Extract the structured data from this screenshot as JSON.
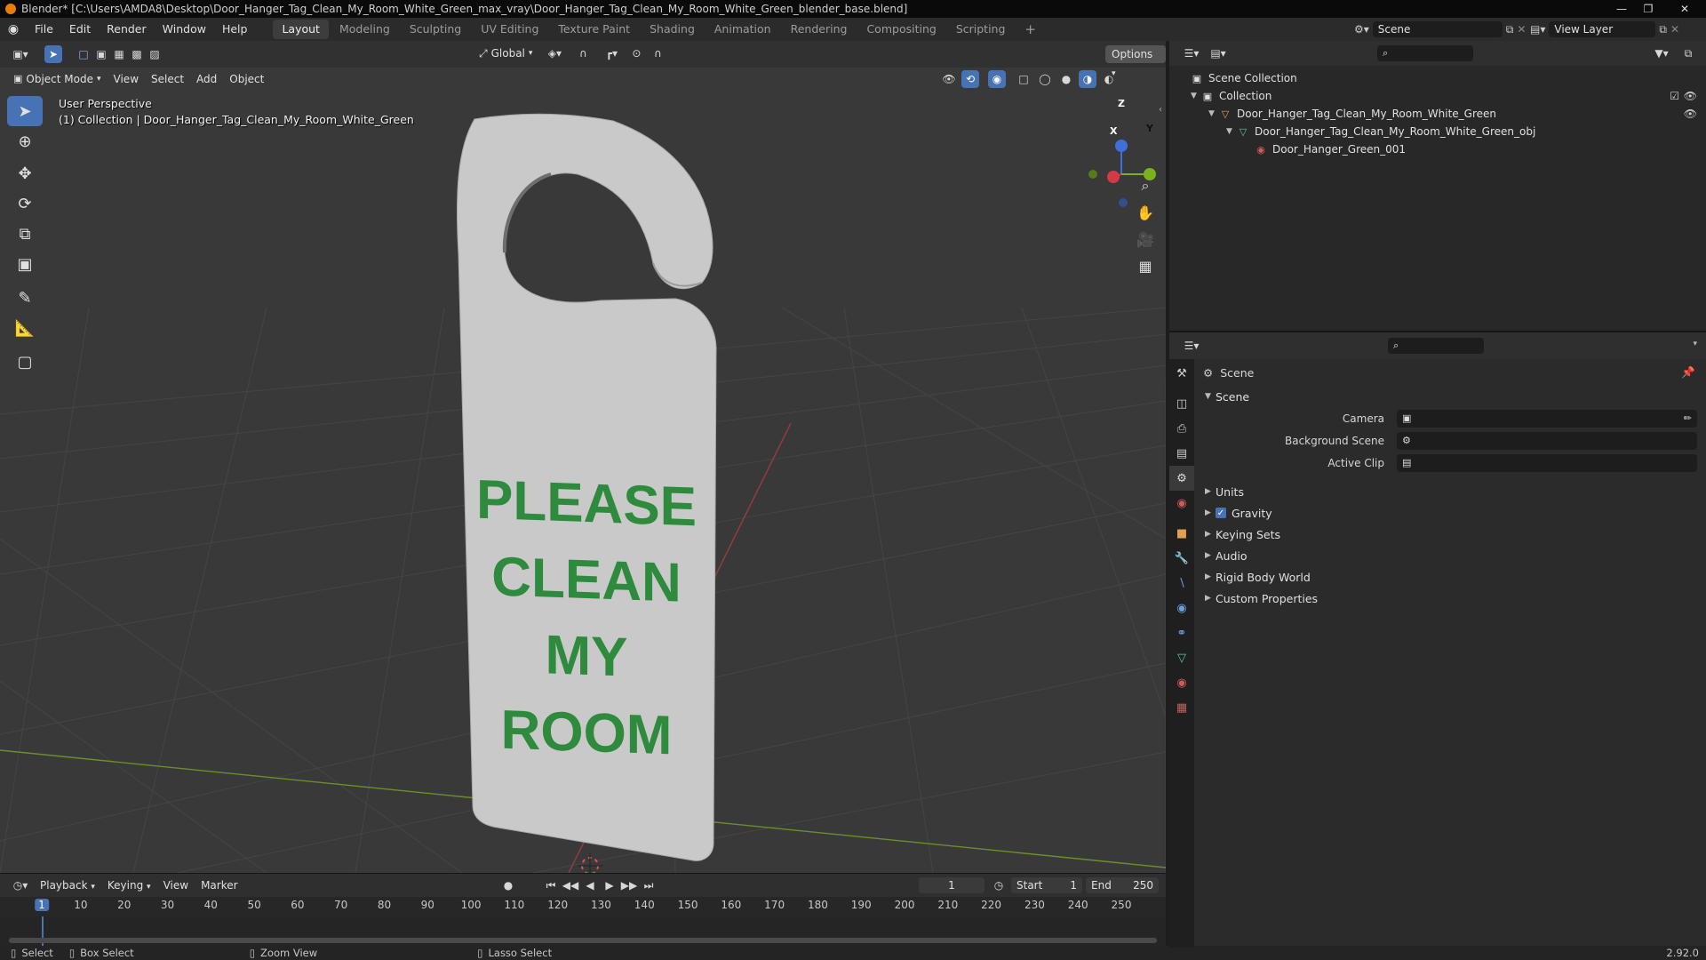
{
  "titlebar": {
    "title": "Blender* [C:\\Users\\AMDA8\\Desktop\\Door_Hanger_Tag_Clean_My_Room_White_Green_max_vray\\Door_Hanger_Tag_Clean_My_Room_White_Green_blender_base.blend]"
  },
  "menu": {
    "file": "File",
    "edit": "Edit",
    "render": "Render",
    "window": "Window",
    "help": "Help"
  },
  "workspaces": [
    "Layout",
    "Modeling",
    "Sculpting",
    "UV Editing",
    "Texture Paint",
    "Shading",
    "Animation",
    "Rendering",
    "Compositing",
    "Scripting"
  ],
  "topright": {
    "scene": "Scene",
    "view_layer": "View Layer"
  },
  "viewport": {
    "mode": "Object Mode",
    "menu": [
      "View",
      "Select",
      "Add",
      "Object"
    ],
    "orientation": "Global",
    "options": "Options",
    "info_line1": "User Perspective",
    "info_line2": "(1) Collection | Door_Hanger_Tag_Clean_My_Room_White_Green",
    "hanger_text": [
      "PLEASE",
      "CLEAN",
      "MY",
      "ROOM"
    ],
    "hanger_text_color": "#2e8a3c",
    "hanger_color": "#c9c9c9",
    "gizmo": {
      "x": "X",
      "y": "Y",
      "z": "Z"
    }
  },
  "timeline": {
    "menu": [
      "Playback",
      "Keying",
      "View",
      "Marker"
    ],
    "current_frame": "1",
    "start_label": "Start",
    "start": "1",
    "end_label": "End",
    "end": "250",
    "ticks": [
      "1",
      "10",
      "20",
      "30",
      "40",
      "50",
      "60",
      "70",
      "80",
      "90",
      "100",
      "110",
      "120",
      "130",
      "140",
      "150",
      "160",
      "170",
      "180",
      "190",
      "200",
      "210",
      "220",
      "230",
      "240",
      "250"
    ]
  },
  "statusbar": {
    "select": "Select",
    "box_select": "Box Select",
    "zoom_view": "Zoom View",
    "lasso_select": "Lasso Select",
    "version": "2.92.0"
  },
  "outliner": {
    "scene_collection": "Scene Collection",
    "collection": "Collection",
    "object": "Door_Hanger_Tag_Clean_My_Room_White_Green",
    "mesh": "Door_Hanger_Tag_Clean_My_Room_White_Green_obj",
    "material": "Door_Hanger_Green_001"
  },
  "properties": {
    "context": "Scene",
    "section_scene": "Scene",
    "camera_label": "Camera",
    "bg_scene_label": "Background Scene",
    "active_clip_label": "Active Clip",
    "sections": [
      "Units",
      "Gravity",
      "Keying Sets",
      "Audio",
      "Rigid Body World",
      "Custom Properties"
    ]
  }
}
